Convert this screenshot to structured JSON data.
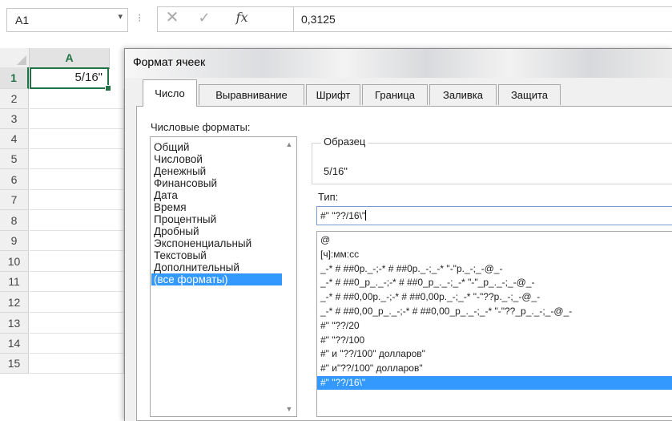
{
  "formula_bar": {
    "name_box": "A1",
    "cancel_icon": "✕",
    "enter_icon": "✓",
    "fx_icon": "fx",
    "value": "0,3125"
  },
  "sheet": {
    "columns": [
      "A"
    ],
    "rows": [
      "1",
      "2",
      "3",
      "4",
      "5",
      "6",
      "7",
      "8",
      "9",
      "10",
      "11",
      "12",
      "13",
      "14",
      "15"
    ],
    "active_cell_value": "5/16\""
  },
  "dialog": {
    "title": "Формат ячеек",
    "tabs": [
      "Число",
      "Выравнивание",
      "Шрифт",
      "Граница",
      "Заливка",
      "Защита"
    ],
    "active_tab": "Число",
    "number_formats_label": "Числовые форматы:",
    "categories": [
      "Общий",
      "Числовой",
      "Денежный",
      "Финансовый",
      "Дата",
      "Время",
      "Процентный",
      "Дробный",
      "Экспоненциальный",
      "Текстовый",
      "Дополнительный",
      "(все форматы)"
    ],
    "selected_category": "(все форматы)",
    "sample_label": "Образец",
    "sample_value": "5/16\"",
    "type_label": "Тип:",
    "type_value": "#\" \"??/16\\\"",
    "formats": [
      "@",
      "[ч]:мм:сс",
      "_-* # ##0р._-;-* # ##0р._-;_-* \"-\"р._-;_-@_-",
      "_-* # ##0_р_._-;-* # ##0_р_._-;_-* \"-\"_р_._-;_-@_-",
      "_-* # ##0,00р._-;-* # ##0,00р._-;_-* \"-\"??р._-;_-@_-",
      "_-* # ##0,00_р_._-;-* # ##0,00_р_._-;_-* \"-\"??_р_._-;_-@_-",
      "#\" \"??/20",
      "#\" \"??/100",
      "#\" и \"??/100\" долларов\"",
      "#\" и\"??/100\" долларов\"",
      "#\" \"??/16\\\""
    ],
    "selected_format_index": 10
  }
}
